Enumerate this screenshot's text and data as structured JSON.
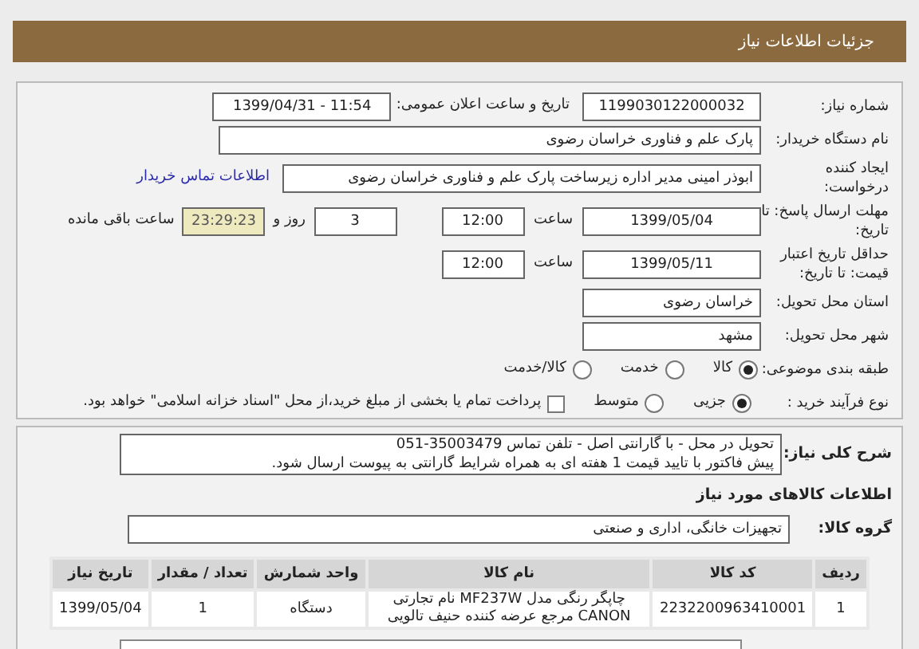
{
  "header": {
    "title": "جزئیات اطلاعات نیاز"
  },
  "need_number": {
    "label": "شماره نیاز:",
    "value": "1199030122000032"
  },
  "announce": {
    "label": "تاریخ و ساعت اعلان عمومی:",
    "value": "1399/04/31 - 11:54"
  },
  "buyer_org": {
    "label": "نام دستگاه خریدار:",
    "value": "پارک علم و فناوری خراسان رضوی"
  },
  "creator": {
    "label": "ایجاد کننده درخواست:",
    "value": "ابوذر امینی مدیر اداره زیرساخت پارک علم و فناوری خراسان رضوی",
    "link": "اطلاعات تماس خریدار"
  },
  "deadline": {
    "label": "مهلت ارسال پاسخ: تا تاریخ:",
    "date": "1399/05/04",
    "time_label": "ساعت",
    "time": "12:00",
    "days": "3",
    "days_label": "روز و",
    "remaining": "23:29:23",
    "remaining_label": "ساعت باقی مانده"
  },
  "validity": {
    "label": "حداقل تاریخ اعتبار قیمت: تا تاریخ:",
    "date": "1399/05/11",
    "time_label": "ساعت",
    "time": "12:00"
  },
  "province": {
    "label": "استان محل تحویل:",
    "value": "خراسان رضوی"
  },
  "city": {
    "label": "شهر محل تحویل:",
    "value": "مشهد"
  },
  "category": {
    "label": "طبقه بندی موضوعی:",
    "options": [
      {
        "label": "کالا",
        "selected": true
      },
      {
        "label": "خدمت",
        "selected": false
      },
      {
        "label": "کالا/خدمت",
        "selected": false
      }
    ]
  },
  "purchase_type": {
    "label": "نوع فرآیند خرید :",
    "options": [
      {
        "label": "جزیی",
        "selected": true
      },
      {
        "label": "متوسط",
        "selected": false
      }
    ],
    "payment": {
      "label": "پرداخت تمام یا بخشی از مبلغ خرید،از محل \"اسناد خزانه اسلامی\" خواهد بود.",
      "checked": false
    }
  },
  "description": {
    "label": "شرح کلی نیاز:",
    "lines": [
      "تحویل در محل - با گارانتی اصل - تلفن تماس 35003479-051",
      "پیش فاکتور با تایید قیمت 1 هفته ای به همراه شرایط گارانتی به پیوست ارسال شود."
    ]
  },
  "goods_title": "اطلاعات کالاهای مورد نیاز",
  "goods_group": {
    "label": "گروه کالا:",
    "value": "تجهیزات خانگی، اداری و صنعتی"
  },
  "table": {
    "columns": [
      "ردیف",
      "کد کالا",
      "نام کالا",
      "واحد شمارش",
      "تعداد / مقدار",
      "تاریخ نیاز"
    ],
    "rows": [
      [
        "1",
        "2232200963410001",
        "چاپگر رنگی مدل MF237W نام تجارتی CANON مرجع عرضه کننده حنیف تالویی",
        "دستگاه",
        "1",
        "1399/05/04"
      ]
    ]
  }
}
